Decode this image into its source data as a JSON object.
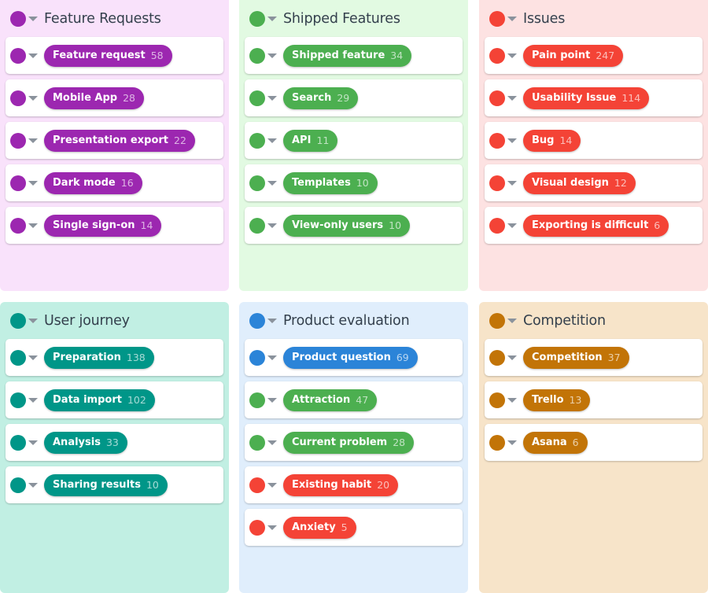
{
  "colors": {
    "purple": "#9c27b0",
    "green": "#4caf50",
    "red": "#f44336",
    "teal": "#009688",
    "blue": "#2b84d8",
    "orange": "#c27407"
  },
  "groups": [
    {
      "title": "Feature Requests",
      "color": "#9c27b0",
      "background": "#f9e2fb",
      "items": [
        {
          "label": "Feature request",
          "count": "58",
          "color": "#9c27b0"
        },
        {
          "label": "Mobile App",
          "count": "28",
          "color": "#9c27b0"
        },
        {
          "label": "Presentation export",
          "count": "22",
          "color": "#9c27b0"
        },
        {
          "label": "Dark mode",
          "count": "16",
          "color": "#9c27b0"
        },
        {
          "label": "Single sign-on",
          "count": "14",
          "color": "#9c27b0"
        }
      ]
    },
    {
      "title": "Shipped Features",
      "color": "#4caf50",
      "background": "#e2fae2",
      "items": [
        {
          "label": "Shipped feature",
          "count": "34",
          "color": "#4caf50"
        },
        {
          "label": "Search",
          "count": "29",
          "color": "#4caf50"
        },
        {
          "label": "API",
          "count": "11",
          "color": "#4caf50"
        },
        {
          "label": "Templates",
          "count": "10",
          "color": "#4caf50"
        },
        {
          "label": "View-only users",
          "count": "10",
          "color": "#4caf50"
        }
      ]
    },
    {
      "title": "Issues",
      "color": "#f44336",
      "background": "#fde2e2",
      "items": [
        {
          "label": "Pain point",
          "count": "247",
          "color": "#f44336"
        },
        {
          "label": "Usability Issue",
          "count": "114",
          "color": "#f44336"
        },
        {
          "label": "Bug",
          "count": "14",
          "color": "#f44336"
        },
        {
          "label": "Visual design",
          "count": "12",
          "color": "#f44336"
        },
        {
          "label": "Exporting is difficult",
          "count": "6",
          "color": "#f44336"
        }
      ]
    },
    {
      "title": "User journey",
      "color": "#009688",
      "background": "#c1efe3",
      "items": [
        {
          "label": "Preparation",
          "count": "138",
          "color": "#009688"
        },
        {
          "label": "Data import",
          "count": "102",
          "color": "#009688"
        },
        {
          "label": "Analysis",
          "count": "33",
          "color": "#009688"
        },
        {
          "label": "Sharing results",
          "count": "10",
          "color": "#009688"
        }
      ]
    },
    {
      "title": "Product evaluation",
      "color": "#2b84d8",
      "background": "#e0eefc",
      "items": [
        {
          "label": "Product question",
          "count": "69",
          "color": "#2b84d8"
        },
        {
          "label": "Attraction",
          "count": "47",
          "color": "#4caf50"
        },
        {
          "label": "Current problem",
          "count": "28",
          "color": "#4caf50"
        },
        {
          "label": "Existing habit",
          "count": "20",
          "color": "#f44336"
        },
        {
          "label": "Anxiety",
          "count": "5",
          "color": "#f44336"
        }
      ]
    },
    {
      "title": "Competition",
      "color": "#c27407",
      "background": "#f7e4c9",
      "items": [
        {
          "label": "Competition",
          "count": "37",
          "color": "#c27407"
        },
        {
          "label": "Trello",
          "count": "13",
          "color": "#c27407"
        },
        {
          "label": "Asana",
          "count": "6",
          "color": "#c27407"
        }
      ]
    }
  ]
}
